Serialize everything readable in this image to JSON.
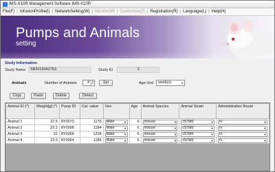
{
  "window": {
    "title": "IMS-X10R Management Software IMS-X10R"
  },
  "menu": {
    "items": [
      {
        "label": "File(F)",
        "enabled": true
      },
      {
        "label": "InfusionProfile(I)",
        "enabled": true
      },
      {
        "label": "NetworkSetting(W)",
        "enabled": true
      },
      {
        "label": "Monitor(M)",
        "enabled": false
      },
      {
        "label": "Customize(Z)",
        "enabled": false
      },
      {
        "label": "Registration(R)",
        "enabled": true
      },
      {
        "label": "Language(L)",
        "enabled": true
      },
      {
        "label": "Help(H)",
        "enabled": true
      }
    ]
  },
  "banner": {
    "title": "Pumps and Animals",
    "subtitle": "setting"
  },
  "study": {
    "section_title": "Study Information",
    "name_label": "Study Name",
    "name_value": "SB2019042753",
    "id_label": "Study ID",
    "id_value": "3"
  },
  "animals": {
    "label": "Animals",
    "count_label": "Number of Animals",
    "count_value": "4",
    "set_button": "Set",
    "age_unit_label": "Age Unit",
    "age_unit_value": "week(s)"
  },
  "actions": {
    "copy": "Copy",
    "paste": "Paste",
    "delete": "Delete",
    "detect": "Detect"
  },
  "grid": {
    "headers": [
      "Animal ID (*)",
      "Weight[g] (*)",
      "Pump ID",
      "Cal. value",
      "Sex",
      "Age",
      "Animal Species",
      "Animal Strain",
      "Administration Route"
    ],
    "rows": [
      [
        "Animal 1",
        "22.5",
        "8Y0073",
        "1176",
        "Male",
        "6",
        "mouse",
        "c57bl6",
        "iv"
      ],
      [
        "Animal 2",
        "23.2",
        "8Y0098",
        "1184",
        "Male",
        "6",
        "mouse",
        "c57bl6",
        "iv"
      ],
      [
        "Animal 3",
        "22",
        "8Y0068",
        "1208",
        "Male",
        "6",
        "mouse",
        "c57bl6",
        "iv"
      ],
      [
        "Animal 4",
        "23.5",
        "8Y0064",
        "1186",
        "Male",
        "6",
        "mouse",
        "c57bl6",
        "iv"
      ]
    ]
  }
}
